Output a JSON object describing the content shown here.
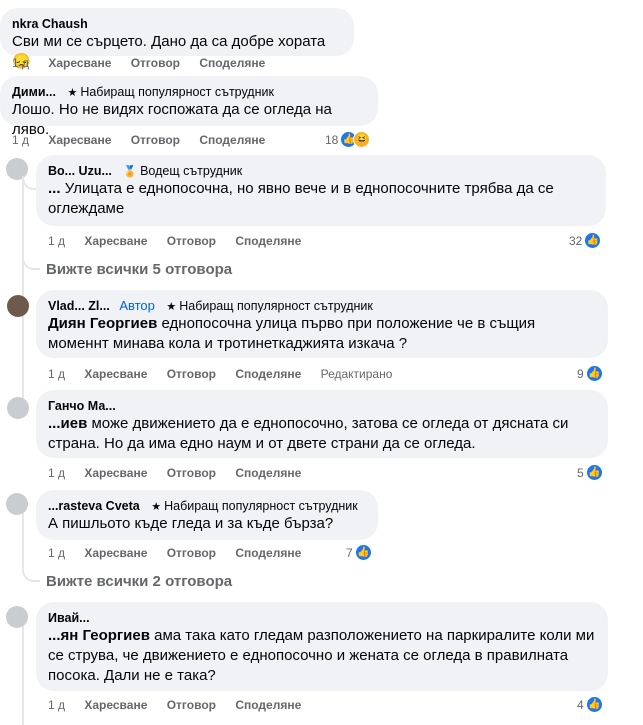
{
  "comments": [
    {
      "name": "nkra Chaush",
      "badge": "",
      "text": "Сви ми се сърцето. Дано да са добре хората 😞",
      "time": "1 д",
      "like": "Харесване",
      "reply": "Отговор",
      "share": "Споделяне",
      "reactions": ""
    },
    {
      "name": "Дими...",
      "badge": "Набиращ популярност сътрудник",
      "text": "Лошо. Но не видях госпожата да се огледа на ляво.",
      "time": "1 д",
      "like": "Харесване",
      "reply": "Отговор",
      "share": "Споделяне",
      "reactions": "18"
    },
    {
      "name": "Bo... Uzu...",
      "badge": "Водещ сътрудник",
      "mention": "...",
      "text": "Улицата е еднопосочна, но явно вече и в еднопосочните трябва да се оглеждаме",
      "time": "1 д",
      "like": "Харесване",
      "reply": "Отговор",
      "share": "Споделяне",
      "reactions": "32"
    },
    {
      "name": "Vlad... Zl...",
      "author": "Автор",
      "badge": "Набиращ популярност сътрудник",
      "mention": "Диян Георгиев",
      "text": "еднопосочна улица първо при положение че в същия моменнт минава кола и тротинеткаджията изкача ?",
      "time": "1 д",
      "like": "Харесване",
      "reply": "Отговор",
      "share": "Споделяне",
      "edited": "Редактирано",
      "reactions": "9"
    },
    {
      "name": "Ганчо Ма...",
      "badge": "",
      "mention": "...иев",
      "text": "може движението да е еднопосочно, затова се огледа от дясната си страна. Но да има едно наум и от двете страни да се огледа.",
      "time": "1 д",
      "like": "Харесване",
      "reply": "Отговор",
      "share": "Споделяне",
      "reactions": "5"
    },
    {
      "name": "...rasteva Cveta",
      "badge": "Набиращ популярност сътрудник",
      "text": "А пишльото къде гледа и за къде бърза?",
      "time": "1 д",
      "like": "Харесване",
      "reply": "Отговор",
      "share": "Споделяне",
      "reactions": "7"
    },
    {
      "name": "Ивай...",
      "badge": "",
      "mention": "...ян Георгиев",
      "text": "ама така като гледам разположението на паркиралите коли ми се струва, че движението е еднопосочно и жената се огледа в правилната посока. Дали не е така?",
      "time": "1 д",
      "like": "Харесване",
      "reply": "Отговор",
      "share": "Споделяне",
      "reactions": "4"
    }
  ],
  "view_all_1": "Вижте всички 5 отговора",
  "view_all_2": "Вижте всички 2 отговора",
  "icons": {
    "like": "thumbs-up-icon",
    "haha": "haha-emoji-icon",
    "badge_star": "star-icon",
    "badge_top": "medal-icon"
  },
  "colors": {
    "bubble": "#f0f2f5",
    "secondary_text": "#65676b",
    "like_blue": "#1877f2",
    "author_blue": "#0064d1"
  }
}
